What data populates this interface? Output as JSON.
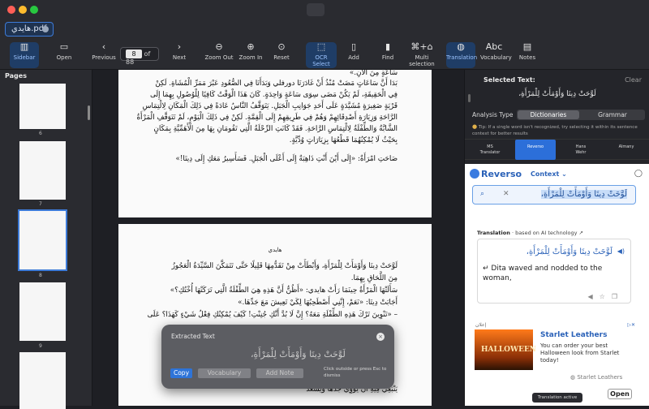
{
  "window": {
    "tab_title": "هايدي.pdf"
  },
  "toolbar": {
    "sidebar": "Sidebar",
    "open": "Open",
    "previous": "Previous",
    "page_current": "8",
    "page_total": "of 88",
    "next": "Next",
    "zoom_out": "Zoom Out",
    "zoom_in": "Zoom In",
    "reset": "Reset",
    "ocr_select": "OCR Select",
    "add": "Add",
    "find": "Find",
    "multi_selection": "Multi selection",
    "translation": "Translation",
    "vocabulary": "Vocabulary",
    "notes": "Notes"
  },
  "sidebar": {
    "title": "Pages",
    "pages": [
      "6",
      "7",
      "8",
      "9"
    ]
  },
  "document": {
    "page1_lines": [
      "سَاعَةٍ مِنَ الْآنِ.»",
      "بَدَا أَنَّ سَاعَاتٍ مَضَتْ مُنْذُ أَنْ غَادَرَتَا دورفلي وَبَدَأَتَا فِي الصُّعُودِ عَبْرَ مَمَرِّ الْمُشَاةِ. لَكِنْ",
      "فِي الْحَقِيقَةِ، لَمْ يَكُنْ مَضَى سِوَى سَاعَةٍ وَاحِدَةٍ. كَانَ هَذَا الْوَقْتُ كَافِيًا لِلْوُصُولِ بِهِمَا إِلَى",
      "قَرْيَةٍ صَغِيرَةٍ مُشَيَّدَةٍ عَلَى أَحَدِ جَوَانِبِ الْجَبَلِ. يَتَوَقَّفُ النَّاسُ عَادَةً فِي ذَلِكَ الْمَكَانِ لِالْتِمَاسِ",
      "الرَّاحَةِ وَزِيَارَةِ أَصْدِقَائِهِمْ وَهُمْ فِي طَرِيقِهِمْ إِلَى الْقِمَّةِ. لَكِنْ فِي ذَلِكَ الْيَوْمِ، لَمْ تَتَوَقَّفِ الْمَرْأَةُ",
      "الشَّابَّةُ وَالطِّفْلَةُ لِالْتِمَاسِ الرَّاحَةِ. فَقَدْ كَانَتِ الرِّحْلَةُ الَّتِي تَقُومَانِ بِهَا مِنَ الْأَهَمِّيَّةِ بِمَكَانٍ",
      "بِحَيْثُ لَا يُمْكِنُهُمَا قَطْعُهَا بِزِيَارَاتٍ وُدِّيَّةٍ.",
      "صَاحَتِ امْرَأَةٌ: «إِلَى أَيْنَ أَنْتِ ذَاهِبَةٌ إِلَى أَعْلَى الْجَبَلِ. فَسَأَسِيرُ مَعَكِ إِلَى دِيتَا!»"
    ],
    "page2_header": "هايدي",
    "page2_lines": [
      "لَوَّحَتْ دِيتَا وَأَوْمَأَتْ لِلْمَرْأَةِ، وَأَبْطَأَتْ مِنْ تَقَدُّمِهَا قَلِيلًا حَتَّى تَتَمَكَّنَ السَّيِّدَةُ الْعَجُوزُ",
      "مِنَ اللَّحَاقِ بِهِمَا.",
      "سَأَلَتْهَا الْمَرْأَةُ حِينَمَا رَأَتْ هايدي: «أَظُنُّ أَنَّ هَذِهِ هِيَ الطِّفْلَةُ الَّتِي تَرَكَتْهَا أُخْتُكِ؟»",
      "أَجَابَتْ دِيتَا: «نَعَمْ، إِنَّنِي أَصْطَحِبُهَا لِكَيْ تَعِيشَ مَعَ جَدِّهَا.»",
      "– «تَنْوِينَ تَرْكَ هَذِهِ الطِّفْلَةِ مَعَهُ؟ إِنَّ لَا بُدَّ أَنَّكِ جُنِنْتِ! كَيْفَ يُمْكِنُكِ فِعْلُ شَيْءٍ كَهَذَا؟ عَلَى",
      "يَنْبَغِي فِيهِ أَنْ يُؤْوِيَ جَدُّهَا وَيَسْعَدَ"
    ]
  },
  "popup": {
    "title": "Extracted Text",
    "text": "لَوَّحَتْ دِيتَا وَأَوْمَأَتْ لِلْمَرْأَةِ،",
    "copy": "Copy",
    "vocabulary": "Vocabulary",
    "add_note": "Add Note",
    "hint": "Click outside or press Esc to dismiss"
  },
  "panel": {
    "selected_label": "Selected Text:",
    "clear": "Clear",
    "selected_text": "لَوَّحَتْ دِيتَا وَأَوْمَأَتْ لِلْمَرْأَةِ،",
    "analysis_label": "Analysis Type",
    "seg_dictionaries": "Dictionaries",
    "seg_grammar": "Grammar",
    "tip": "Tip: If a single word isn't recognized, try selecting it within its sentence context for better results",
    "dict_tabs": [
      {
        "l1": "MS",
        "l2": "Translator"
      },
      {
        "l1": "Reverso",
        "l2": ""
      },
      {
        "l1": "Hans",
        "l2": "Wehr"
      },
      {
        "l1": "Almany",
        "l2": ""
      }
    ]
  },
  "reverso": {
    "logo": "Reverso",
    "context": "Context",
    "query": "لَوَّحَتْ دِيتَا وَأَوْمَأَتْ لِلْمَرْأَةِ،",
    "trans_label": "Translation",
    "trans_sub": "· based on AI technology",
    "trans_ar": "لَوَّحَتْ دِيتَا وَأَوْمَأَتْ لِلْمَرْأَةِ،",
    "trans_en": "Dita waved and nodded to the woman,",
    "ad_label": "إعلان",
    "ad_title": "Starlet Leathers",
    "ad_text": "You can order your best Halloween look from Starlet today!",
    "ad_image_text": "HALLOWEEN",
    "ad_brand": "Starlet Leathers",
    "ad_open": "Open"
  },
  "status": {
    "translation_active": "Translation active"
  }
}
